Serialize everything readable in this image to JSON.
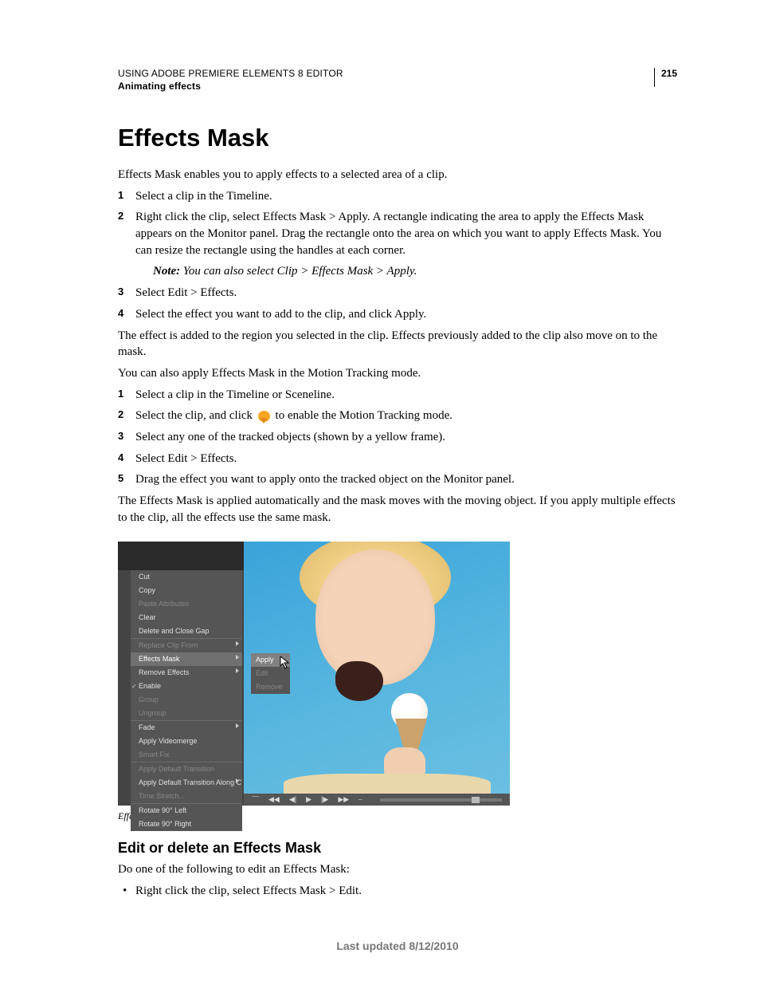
{
  "header": {
    "running_head": "USING ADOBE PREMIERE ELEMENTS 8 EDITOR",
    "section": "Animating effects",
    "page_number": "215"
  },
  "title": "Effects Mask",
  "intro": "Effects Mask enables you to apply effects to a selected area of a clip.",
  "steps_a": {
    "s1": "Select a clip in the Timeline.",
    "s2": "Right click the clip, select Effects Mask > Apply. A rectangle indicating the area to apply the Effects Mask appears on the Monitor panel. Drag the rectangle onto the area on which you want to apply Effects Mask. You can resize the rectangle using the handles at each corner.",
    "note_label": "Note:",
    "note_text": " You can also select Clip > Effects Mask > Apply.",
    "s3": "Select Edit > Effects.",
    "s4": "Select the effect you want to add to the clip, and click Apply."
  },
  "para_after_a": "The effect is added to the region you selected in the clip. Effects previously added to the clip also move on to the mask.",
  "para_mt_intro": "You can also apply Effects Mask in the Motion Tracking mode.",
  "steps_b": {
    "s1": "Select a clip in the Timeline or Sceneline.",
    "s2_pre": "Select the clip, and click ",
    "s2_post": " to enable the Motion Tracking mode.",
    "s3": "Select any one of the tracked objects (shown by a yellow frame).",
    "s4": "Select Edit > Effects.",
    "s5": "Drag the effect you want to apply onto the tracked object on the Monitor panel."
  },
  "para_after_b": "The Effects Mask is applied automatically and the mask moves with the moving object. If you apply multiple effects to the clip, all the effects use the same mask.",
  "ctx": {
    "cut": "Cut",
    "copy": "Copy",
    "paste_attr": "Paste Attributes",
    "clear": "Clear",
    "del_close": "Delete and Close Gap",
    "replace": "Replace Clip From",
    "effects_mask": "Effects Mask",
    "remove_effects": "Remove Effects",
    "enable": "Enable",
    "group": "Group",
    "ungroup": "Ungroup",
    "fade": "Fade",
    "apply_videomerge": "Apply Videomerge",
    "smart_fix": "Smart Fix",
    "apply_def_trans": "Apply Default Transition",
    "apply_def_trans_cti": "Apply Default Transition Along CTI",
    "time_stretch": "Time Stretch...",
    "rot_left": "Rotate 90° Left",
    "rot_right": "Rotate 90° Right"
  },
  "sub": {
    "apply": "Apply",
    "edit": "Edit",
    "remove": "Remove"
  },
  "playbar_icons": [
    "⎺",
    "◀◀",
    "◀|",
    "▶",
    "|▶",
    "▶▶",
    "⎯"
  ],
  "caption": "Effects masking",
  "subhead": "Edit or delete an Effects Mask",
  "subhead_intro": "Do one of the following to edit an Effects Mask:",
  "subhead_bullet": "Right click the clip, select Effects Mask > Edit.",
  "footer": "Last updated 8/12/2010"
}
